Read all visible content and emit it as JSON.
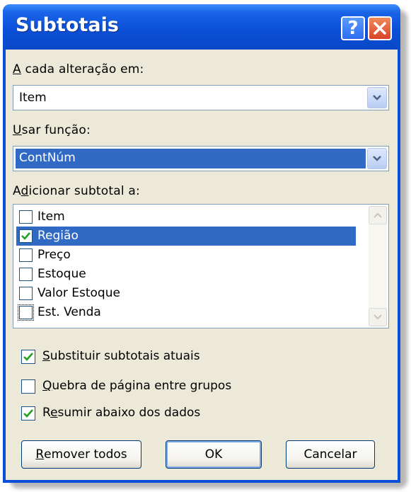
{
  "dialog": {
    "title": "Subtotais",
    "help_icon": "help-icon",
    "close_icon": "close-icon"
  },
  "group_by": {
    "label_underlined": "A",
    "label_rest": " cada alteração em:",
    "value": "Item"
  },
  "function": {
    "label_underlined": "U",
    "label_rest": "sar função:",
    "value": "ContNúm"
  },
  "add_subtotal": {
    "label_pre": "A",
    "label_underlined": "d",
    "label_rest": "icionar subtotal a:",
    "items": [
      {
        "label": "Item",
        "checked": false,
        "selected": false
      },
      {
        "label": "Região",
        "checked": true,
        "selected": true
      },
      {
        "label": "Preço",
        "checked": false,
        "selected": false
      },
      {
        "label": "Estoque",
        "checked": false,
        "selected": false
      },
      {
        "label": "Valor Estoque",
        "checked": false,
        "selected": false
      },
      {
        "label": "Est. Venda",
        "checked": false,
        "selected": false
      }
    ]
  },
  "options": {
    "replace": {
      "underlined": "S",
      "rest": "ubstituir subtotais atuais",
      "checked": true
    },
    "page_break": {
      "underlined": "Q",
      "rest": "uebra de página entre grupos",
      "checked": false
    },
    "summary_below": {
      "pre": "R",
      "underlined": "e",
      "rest": "sumir abaixo dos dados",
      "checked": true
    }
  },
  "buttons": {
    "remove_all": {
      "underlined": "R",
      "rest": "emover todos"
    },
    "ok": "OK",
    "cancel": "Cancelar"
  },
  "colors": {
    "titlebar": "#0a4fd6",
    "selection": "#316ac5",
    "dialog_bg": "#ece9d8",
    "check": "#21a121"
  }
}
